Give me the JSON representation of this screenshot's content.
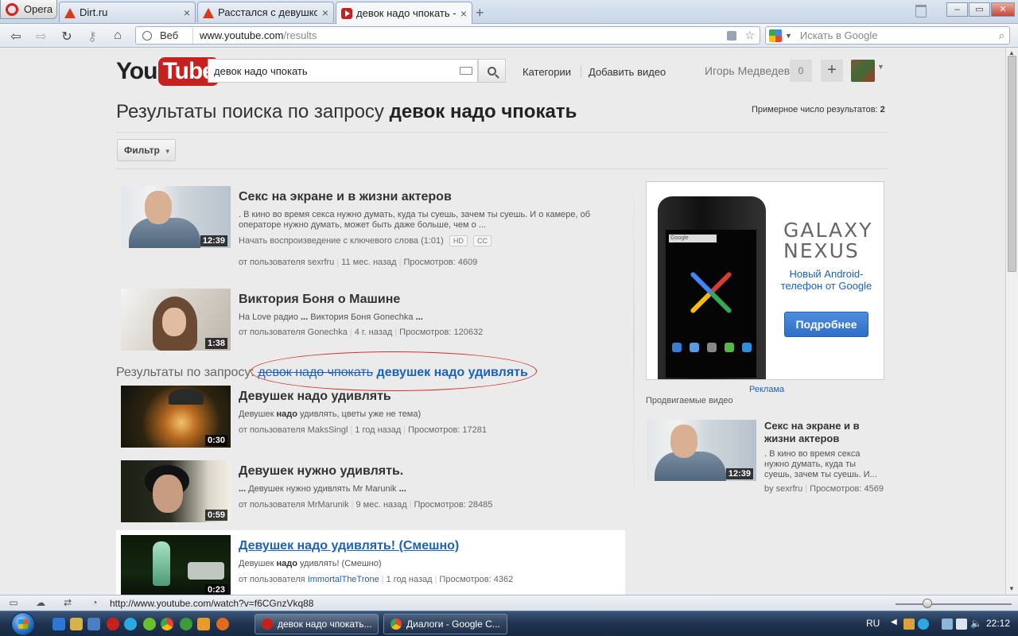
{
  "browser": {
    "opera_label": "Opera",
    "tabs": [
      {
        "label": "Dirt.ru",
        "close": "×"
      },
      {
        "label": "Расстался с девушкой…",
        "close": "×"
      },
      {
        "label": "девок надо чпокать - …",
        "close": "×"
      }
    ],
    "new_tab": "+",
    "window_controls": {
      "minimize": "‒",
      "maximize": "▭",
      "close": "✕"
    },
    "nav": {
      "back": "⇦",
      "forward": "⇨",
      "reload": "↻",
      "key": "⚷",
      "home": "⌂"
    },
    "address": {
      "mode": "Веб",
      "host": "www.youtube.com",
      "path": "/results"
    },
    "search": {
      "placeholder": "Искать в Google"
    }
  },
  "youtube": {
    "logo": {
      "you": "You",
      "tube": "Tube"
    },
    "search_query": "девок надо чпокать",
    "nav_links": {
      "categories": "Категории",
      "upload": "Добавить видео"
    },
    "user": {
      "name": "Игорь Медведев",
      "notifications": "0",
      "plus": "+"
    },
    "results_title_prefix": "Результаты поиска по запросу ",
    "results_title_query": "девок надо чпокать",
    "results_count_label": "Примерное число результатов: ",
    "results_count": "2",
    "filter_label": "Фильтр",
    "correction_prefix": "Результаты по запросу:",
    "correction_struck": "девок надо чпокать",
    "correction_link": "девушек надо удивлять"
  },
  "results": [
    {
      "title": "Секс на экране и в жизни актеров",
      "desc": ". В кино во время секса нужно думать, куда ты суешь, зачем ты суешь. И о камере, об операторе нужно думать, может быть даже больше, чем о ...",
      "extra": "Начать воспроизведение с ключевого слова (1:01)",
      "badges": [
        "HD",
        "CC"
      ],
      "duration": "12:39",
      "by": "от пользователя sexrfru",
      "age": "11 мес. назад",
      "views": "Просмотров: 4609"
    },
    {
      "title": "Виктория Боня о Машине",
      "desc_parts": [
        "На Love радио ",
        "...",
        " Виктория Боня Gonechka ",
        "..."
      ],
      "duration": "1:38",
      "by": "от пользователя Gonechka",
      "age": "4 г. назад",
      "views": "Просмотров: 120632"
    },
    {
      "title": "Девушек надо удивлять",
      "desc_parts": [
        "Девушек ",
        "надо",
        " удивлять, цветы уже не тема)"
      ],
      "duration": "0:30",
      "by": "от пользователя MaksSingl",
      "age": "1 год назад",
      "views": "Просмотров: 17281"
    },
    {
      "title": "Девушек нужно удивлять.",
      "desc_parts": [
        "...",
        " Девушек нужно удивлять Mr Marunik ",
        "..."
      ],
      "duration": "0:59",
      "by": "от пользователя MrMarunik",
      "age": "9 мес. назад",
      "views": "Просмотров: 28485"
    },
    {
      "title": "Девушек надо удивлять! (Смешно)",
      "desc_parts": [
        "Девушек ",
        "надо",
        " удивлять! (Смешно)"
      ],
      "duration": "0:23",
      "by_prefix": "от пользователя ",
      "by_user": "ImmortalTheTrone",
      "age": "1 год назад",
      "views": "Просмотров: 4362"
    }
  ],
  "sidebar": {
    "ad": {
      "brand_line1": "GALAXY",
      "brand_line2": "NEXUS",
      "text": "Новый Android-телефон от Google",
      "button": "Подробнее",
      "phone_search": "Google"
    },
    "ad_label": "Реклама",
    "promo_label": "Продвигаемые видео",
    "promo": {
      "title": "Секс на экране и в жизни актеров",
      "desc": ". В кино во время секса нужно думать, куда ты суешь, зачем ты суешь. И...",
      "by": "by sexrfru",
      "views": "Просмотров: 4569",
      "duration": "12:39"
    }
  },
  "statusbar": {
    "url": "http://www.youtube.com/watch?v=f6CGnzVkq88"
  },
  "taskbar": {
    "windows": [
      "девок надо чпокать...",
      "Диалоги - Google C..."
    ],
    "lang": "RU",
    "time": "22:12"
  },
  "colors": {
    "youtube_red": "#c4221f",
    "link_blue": "#1c62b9",
    "ad_button": "#2e6fc7"
  }
}
